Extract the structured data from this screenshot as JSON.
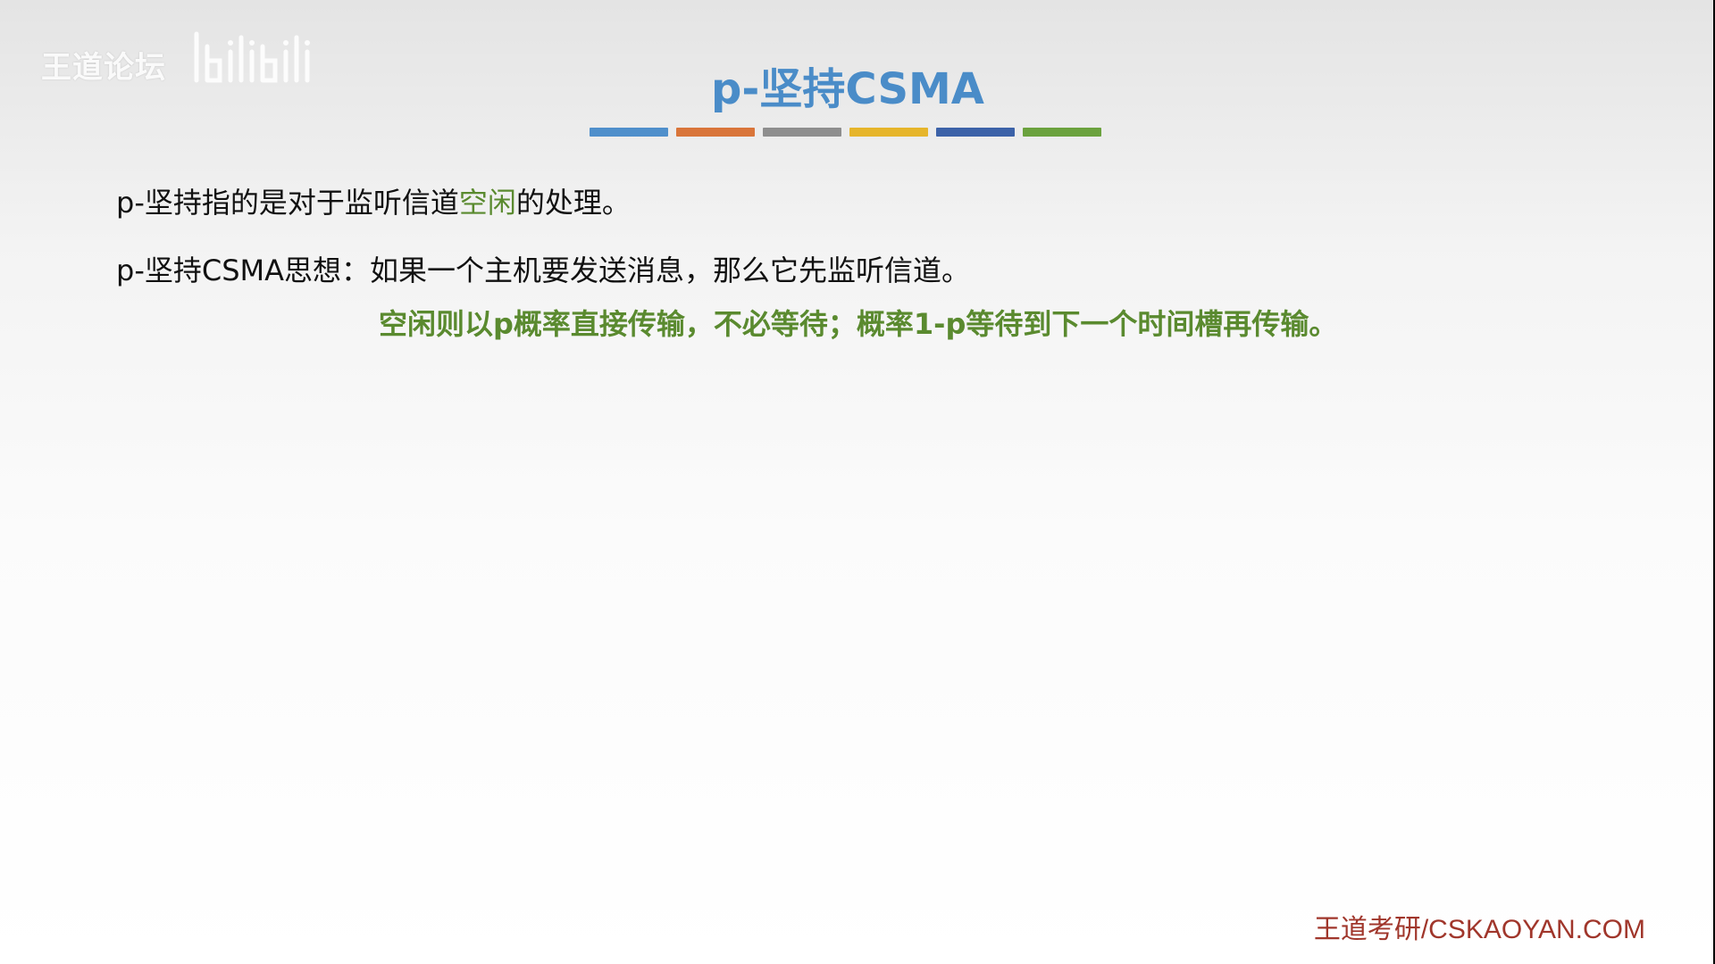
{
  "watermark": {
    "text": "王道论坛",
    "logo_icon": "bilibili-logo-icon"
  },
  "slide": {
    "title": "p-坚持CSMA",
    "title_color": "#4a8cc8",
    "color_bars": [
      "#4f8fcb",
      "#d9753a",
      "#8e8e8e",
      "#e6b52b",
      "#3c62a8",
      "#6ba23e"
    ],
    "line1": {
      "before": "p-坚持指的是对于监听信道",
      "highlight": "空闲",
      "after": "的处理。"
    },
    "line2": "p-坚持CSMA思想：如果一个主机要发送消息，那么它先监听信道。",
    "line3": "空闲则以p概率直接传输，不必等待；概率1-p等待到下一个时间槽再传输。",
    "highlight_color": "#5a8a2f"
  },
  "footer": {
    "text": "王道考研/CSKAOYAN.COM",
    "color": "#a0362b"
  }
}
